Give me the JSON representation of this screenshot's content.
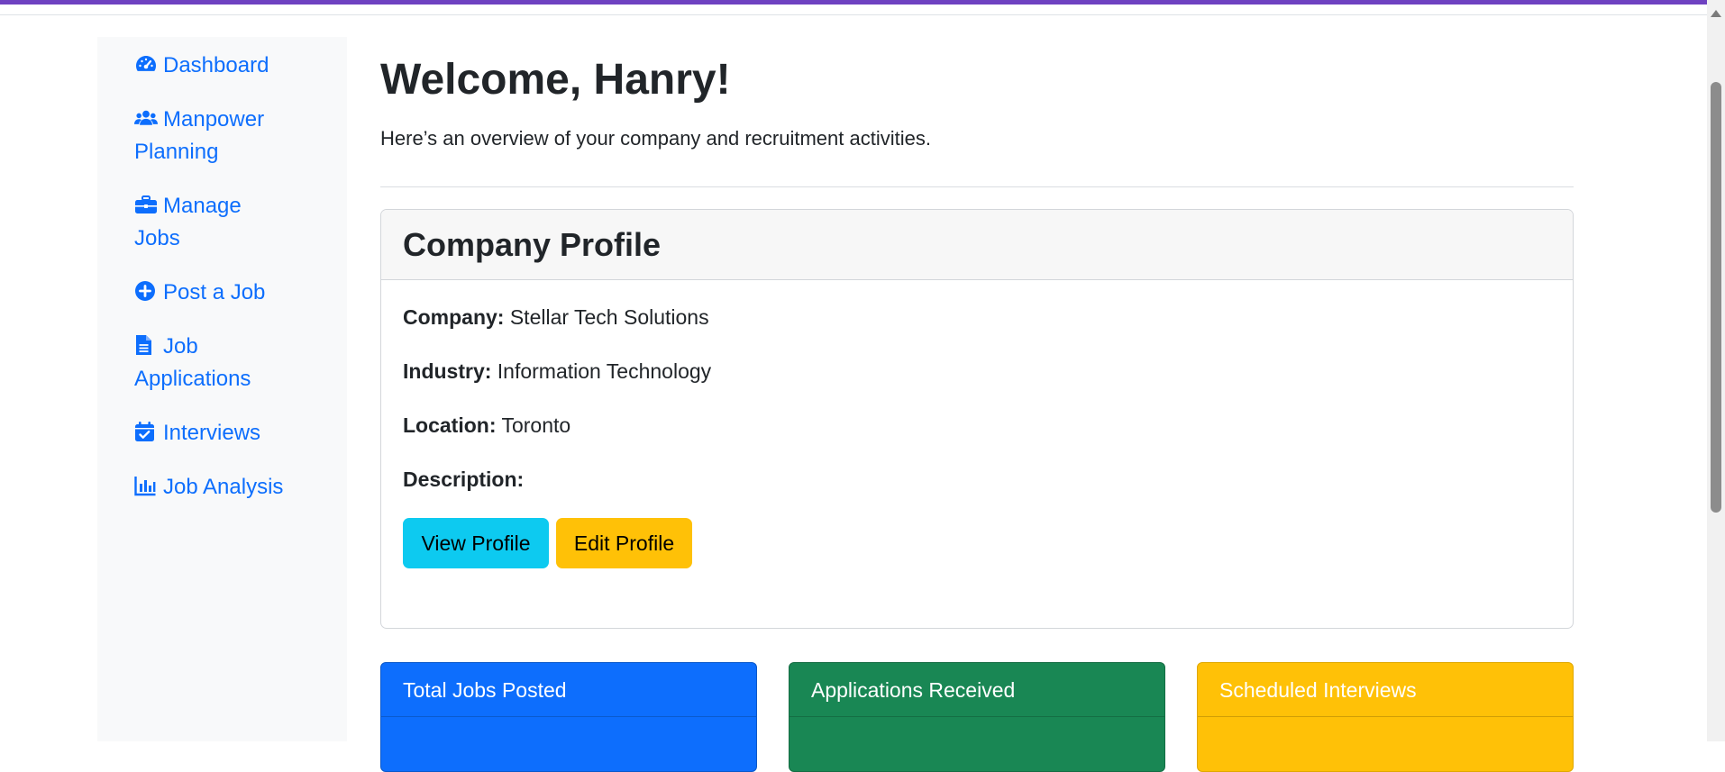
{
  "sidebar": {
    "items": [
      {
        "icon": "gauge-icon",
        "label_lines": [
          "Dashboard"
        ]
      },
      {
        "icon": "users-icon",
        "label_lines": [
          "Manpower",
          "Planning"
        ]
      },
      {
        "icon": "briefcase-icon",
        "label_lines": [
          "Manage",
          "Jobs"
        ]
      },
      {
        "icon": "plus-circle-icon",
        "label_lines": [
          "Post a Job"
        ]
      },
      {
        "icon": "file-icon",
        "label_lines": [
          "Job",
          "Applications"
        ]
      },
      {
        "icon": "calendar-check-icon",
        "label_lines": [
          "Interviews"
        ]
      },
      {
        "icon": "chart-bar-icon",
        "label_lines": [
          "Job Analysis"
        ]
      }
    ]
  },
  "main": {
    "welcome": "Welcome, Hanry!",
    "subtitle": "Here’s an overview of your company and recruitment activities."
  },
  "company_profile": {
    "title": "Company Profile",
    "company_label": "Company:",
    "company_value": "Stellar Tech Solutions",
    "industry_label": "Industry:",
    "industry_value": "Information Technology",
    "location_label": "Location:",
    "location_value": "Toronto",
    "description_label": "Description:",
    "description_value": "",
    "view_button": "View Profile",
    "edit_button": "Edit Profile"
  },
  "stats": [
    {
      "label": "Total Jobs Posted",
      "color": "#0d6efd"
    },
    {
      "label": "Applications Received",
      "color": "#198754"
    },
    {
      "label": "Scheduled Interviews",
      "color": "#ffc107"
    }
  ],
  "colors": {
    "accent": "#0d6efd",
    "top_bar": "#6f42c1",
    "info": "#0dcaf0",
    "warning": "#ffc107"
  }
}
